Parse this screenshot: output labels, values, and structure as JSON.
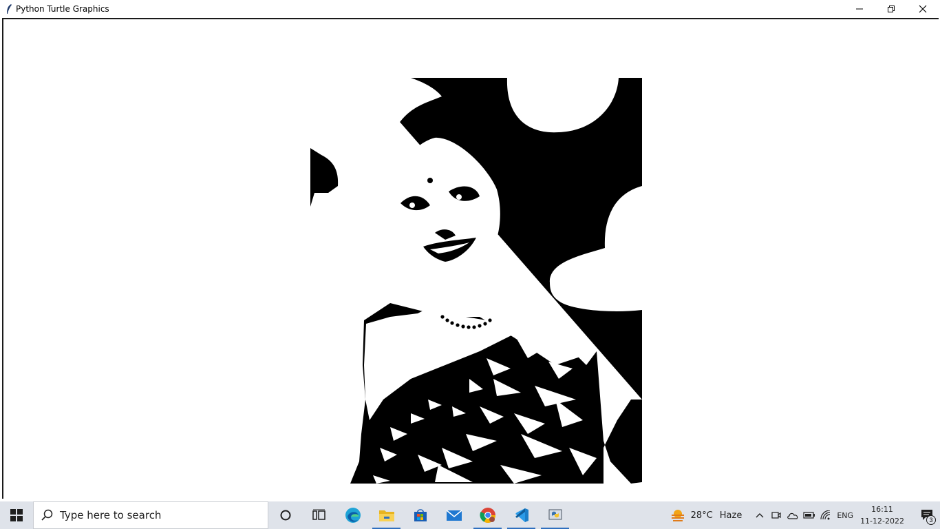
{
  "window": {
    "title": "Python Turtle Graphics",
    "controls": [
      "minimize",
      "restore",
      "close"
    ]
  },
  "canvas": {
    "background": "#ffffff",
    "content": "black-and-white threshold portrait drawing"
  },
  "taskbar": {
    "search_placeholder": "Type here to search",
    "pinned_apps": [
      {
        "name": "cortana-icon"
      },
      {
        "name": "task-view-icon"
      },
      {
        "name": "edge-icon"
      },
      {
        "name": "file-explorer-icon"
      },
      {
        "name": "microsoft-store-icon"
      },
      {
        "name": "mail-icon"
      },
      {
        "name": "chrome-icon"
      },
      {
        "name": "vscode-icon"
      },
      {
        "name": "python-icon"
      }
    ],
    "weather": {
      "temperature": "28°C",
      "condition": "Haze"
    },
    "language": "ENG",
    "clock": {
      "time": "16:11",
      "date": "11-12-2022"
    },
    "notification_count": "3",
    "accent": "#2f6fbf"
  }
}
